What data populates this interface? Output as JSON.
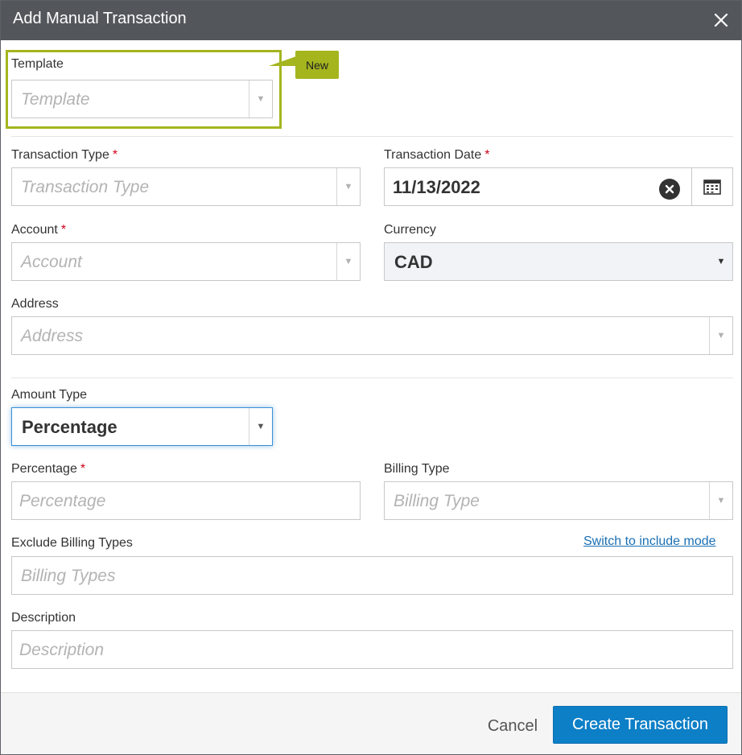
{
  "dialog": {
    "title": "Add Manual Transaction",
    "close_icon": "close-icon"
  },
  "template": {
    "label": "Template",
    "placeholder": "Template",
    "badge": "New",
    "highlight_color": "#a4b51e"
  },
  "transaction_type": {
    "label": "Transaction Type",
    "required": "*",
    "placeholder": "Transaction Type"
  },
  "transaction_date": {
    "label": "Transaction Date",
    "required": "*",
    "value": "11/13/2022",
    "clear_icon": "clear-circle-icon",
    "calendar_icon": "calendar-icon"
  },
  "account": {
    "label": "Account",
    "required": "*",
    "placeholder": "Account"
  },
  "currency": {
    "label": "Currency",
    "value": "CAD"
  },
  "address": {
    "label": "Address",
    "placeholder": "Address"
  },
  "amount_type": {
    "label": "Amount Type",
    "value": "Percentage"
  },
  "percentage": {
    "label": "Percentage",
    "required": "*",
    "placeholder": "Percentage"
  },
  "billing_type": {
    "label": "Billing Type",
    "placeholder": "Billing Type"
  },
  "exclude_billing_types": {
    "label": "Exclude Billing Types",
    "placeholder": "Billing Types",
    "switch_link": "Switch to include mode"
  },
  "description": {
    "label": "Description",
    "placeholder": "Description"
  },
  "footer": {
    "cancel_label": "Cancel",
    "create_label": "Create Transaction"
  },
  "colors": {
    "titlebar": "#53575c",
    "primary": "#0d7fc7",
    "required": "#d0021b",
    "link": "#1a6fb3",
    "focus": "#3a8fd6"
  }
}
